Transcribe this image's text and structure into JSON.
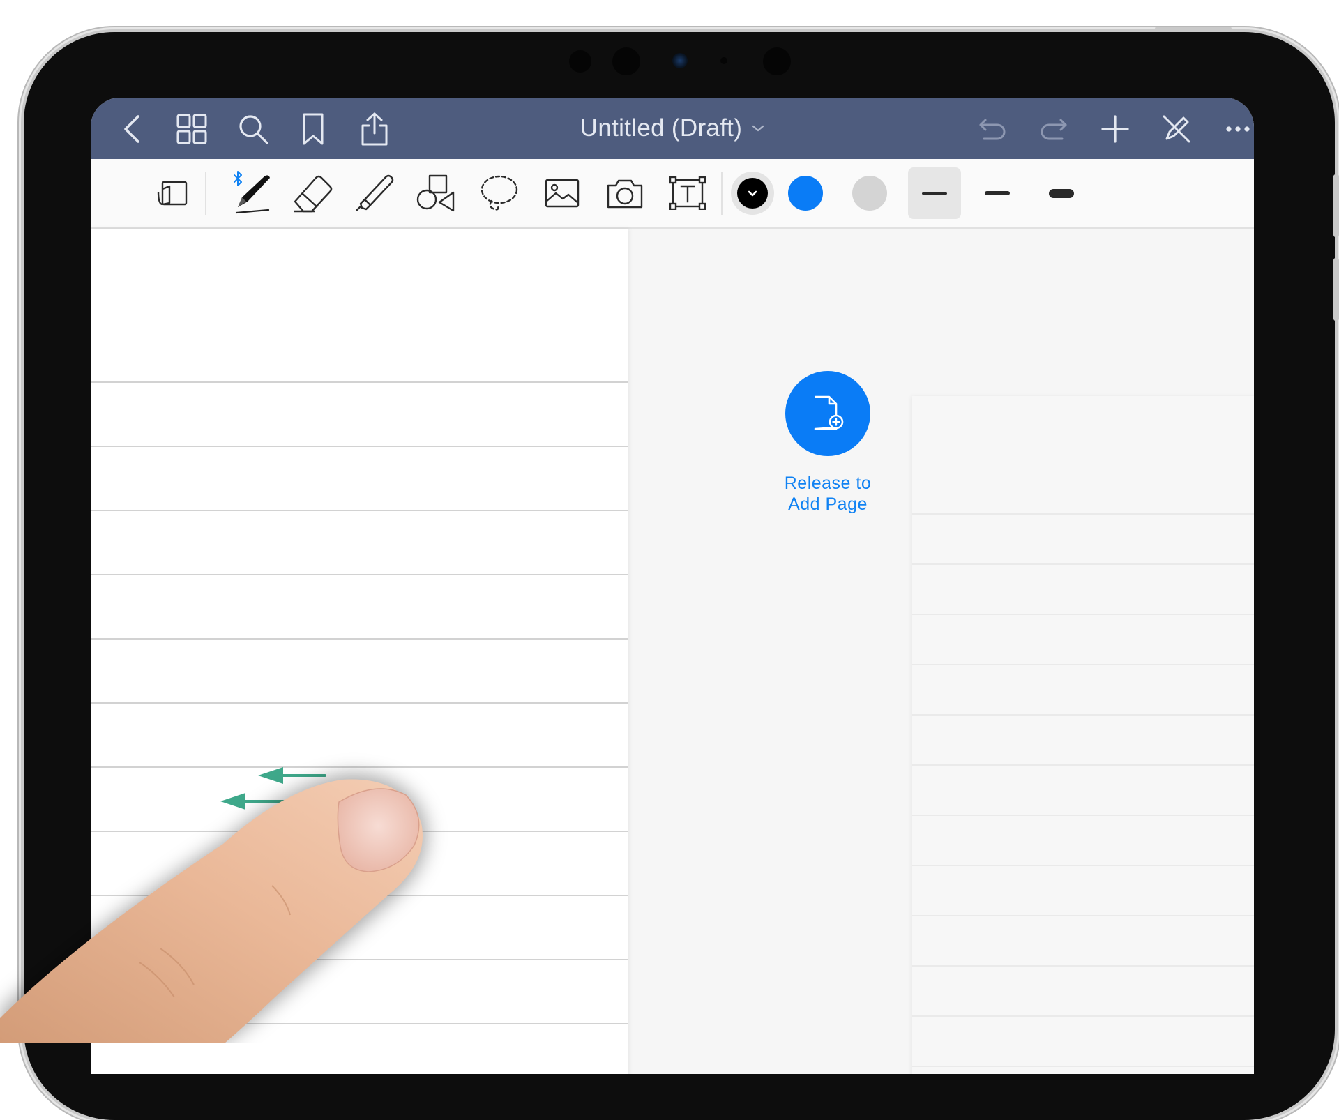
{
  "app": {
    "document_title": "Untitled (Draft)",
    "accent_color": "#0a7cf6",
    "navbar_color": "#4e5c7e"
  },
  "nav": {
    "left_icons": [
      "chevron-left-icon",
      "grid-icon",
      "search-icon",
      "bookmark-icon",
      "share-icon"
    ],
    "right_icons": [
      "undo-icon",
      "redo-icon",
      "plus-icon",
      "pen-off-icon",
      "more-icon"
    ]
  },
  "toolbar": {
    "tools": [
      "read-only-mode-icon",
      "pen-icon",
      "eraser-icon",
      "highlighter-icon",
      "shapes-icon",
      "lasso-icon",
      "image-icon",
      "camera-icon",
      "text-box-icon"
    ],
    "pen_bluetooth": "bluetooth-icon",
    "colors": [
      "#000000",
      "#0a7cf6",
      "#d4d4d4"
    ],
    "selected_color": "#000000",
    "stroke_widths": [
      "thin",
      "medium",
      "thick"
    ],
    "selected_width": "thin"
  },
  "add_page": {
    "icon": "add-page-icon",
    "label_line1": "Release to",
    "label_line2": "Add Page"
  },
  "gesture": {
    "type": "swipe-left",
    "arrow_color": "#3ea88a"
  }
}
